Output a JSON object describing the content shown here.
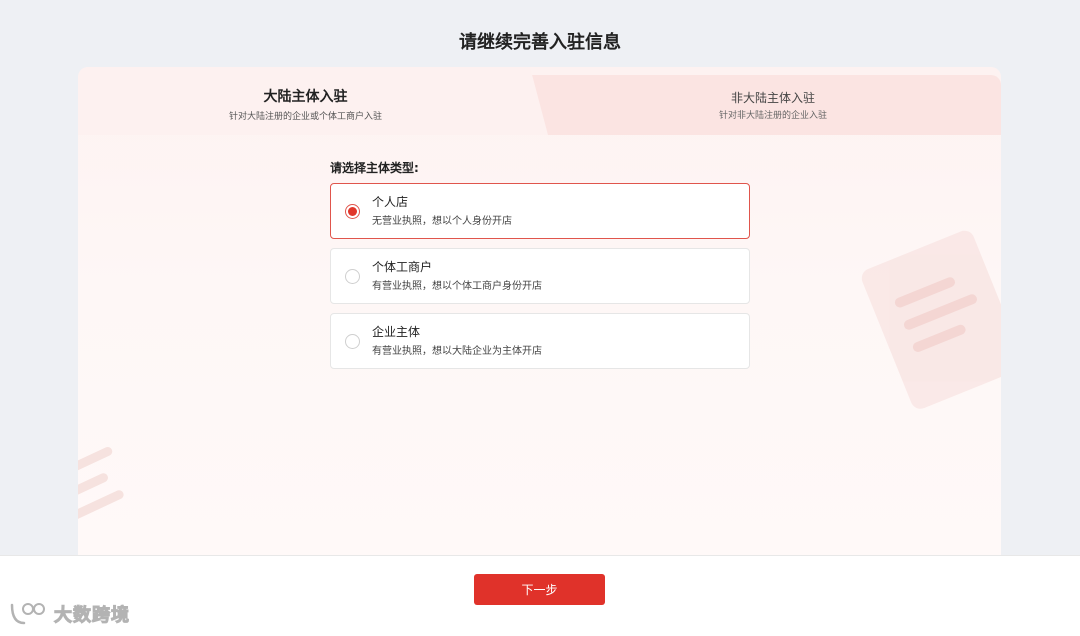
{
  "page": {
    "title": "请继续完善入驻信息"
  },
  "tabs": [
    {
      "title": "大陆主体入驻",
      "subtitle": "针对大陆注册的企业或个体工商户入驻",
      "active": true
    },
    {
      "title": "非大陆主体入驻",
      "subtitle": "针对非大陆注册的企业入驻",
      "active": false
    }
  ],
  "form": {
    "label": "请选择主体类型:",
    "options": [
      {
        "title": "个人店",
        "desc": "无营业执照，想以个人身份开店",
        "selected": true
      },
      {
        "title": "个体工商户",
        "desc": "有营业执照，想以个体工商户身份开店",
        "selected": false
      },
      {
        "title": "企业主体",
        "desc": "有营业执照，想以大陆企业为主体开店",
        "selected": false
      }
    ]
  },
  "footer": {
    "next_label": "下一步"
  },
  "watermark": {
    "text": "大数跨境"
  },
  "colors": {
    "accent": "#e0322a",
    "selected_border": "#e0554c",
    "card_bg": "#fdf2f1"
  }
}
